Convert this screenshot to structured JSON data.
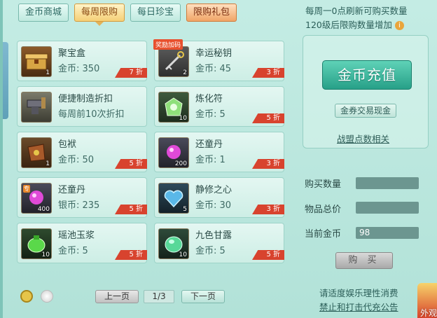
{
  "tabs": [
    {
      "label": "金币商城"
    },
    {
      "label": "每周限购"
    },
    {
      "label": "每日珍宝"
    },
    {
      "label": "限购礼包"
    }
  ],
  "info": {
    "line1": "每周一0点刷新可购买数量",
    "line2": "120级后限购数量增加"
  },
  "items": [
    {
      "name": "聚宝盒",
      "price": "金币: 350",
      "discount": "7 折",
      "qty": "1",
      "icon": "treasure-box-icon"
    },
    {
      "name": "幸运秘钥",
      "price": "金币: 45",
      "discount": "3 折",
      "qty": "2",
      "icon": "key-icon",
      "tag": "奖励加码"
    },
    {
      "name": "便捷制造折扣",
      "price": "每周前10次折扣",
      "discount": "",
      "qty": "",
      "icon": "anvil-icon"
    },
    {
      "name": "炼化符",
      "price": "金币: 5",
      "discount": "5 折",
      "qty": "10",
      "icon": "talisman-icon"
    },
    {
      "name": "包袱",
      "price": "金币: 50",
      "discount": "5 折",
      "qty": "1",
      "icon": "bag-icon"
    },
    {
      "name": "还童丹",
      "price": "金币: 1",
      "discount": "3 折",
      "qty": "200",
      "icon": "pill-icon"
    },
    {
      "name": "还童丹",
      "price": "银币: 235",
      "discount": "5 折",
      "qty": "400",
      "icon": "pill-icon",
      "badge": "专"
    },
    {
      "name": "静修之心",
      "price": "金币: 30",
      "discount": "3 折",
      "qty": "5",
      "icon": "heart-gem-icon"
    },
    {
      "name": "瑶池玉浆",
      "price": "金币: 5",
      "discount": "5 折",
      "qty": "10",
      "icon": "jade-liquid-icon"
    },
    {
      "name": "九色甘露",
      "price": "金币: 5",
      "discount": "5 折",
      "qty": "10",
      "icon": "nectar-icon"
    }
  ],
  "panel": {
    "charge_label": "金币充值",
    "exchange_label": "金券交易现金",
    "alliance_label": "战盟点数相关"
  },
  "form": {
    "qty_label": "购买数量",
    "qty_value": "",
    "total_label": "物品总价",
    "total_value": "",
    "gold_label": "当前金币",
    "gold_value": "98"
  },
  "buy_label": "购 买",
  "pager": {
    "prev_label": "上一页",
    "page_text": "1/3",
    "next_label": "下一页"
  },
  "notices": {
    "line1": "请适度娱乐理性消费",
    "line2": "禁止和打击代充公告"
  },
  "corner_label": "外观",
  "colors": {
    "discount": "#d8432e",
    "charge_button": "#27a088",
    "panel_bg": "#b2e2d8"
  }
}
